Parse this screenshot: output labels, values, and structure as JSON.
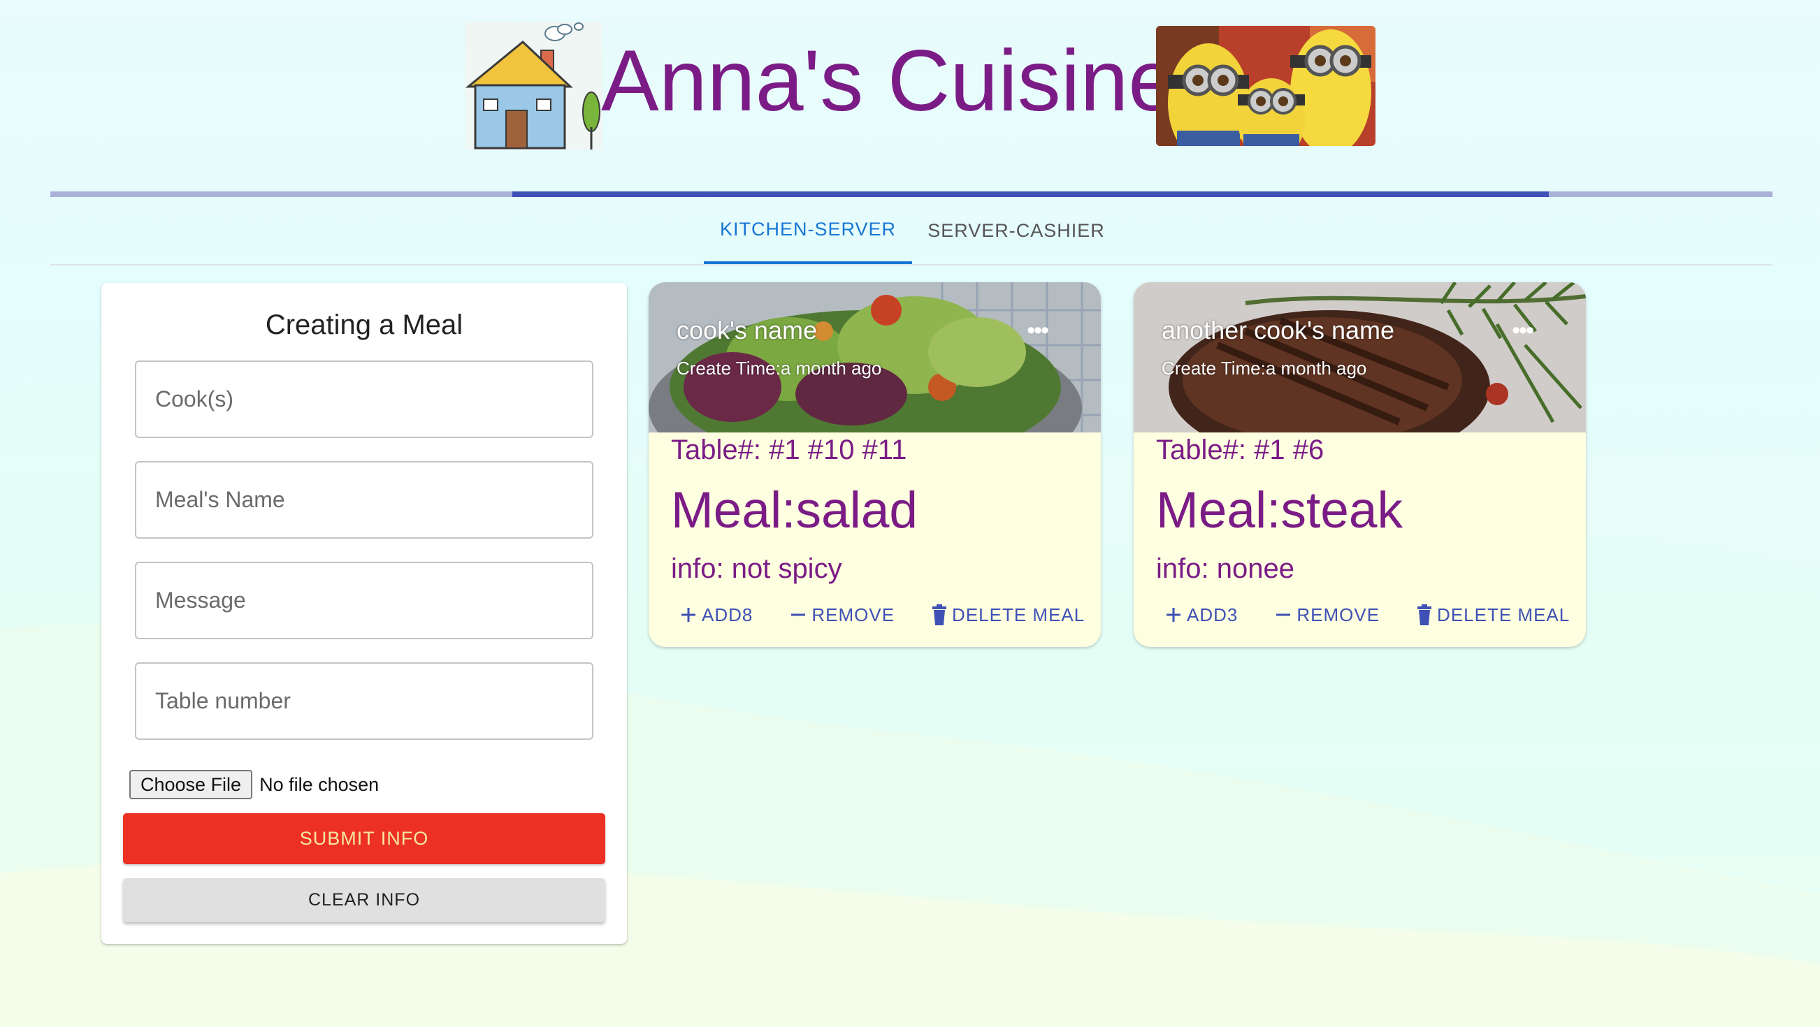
{
  "header": {
    "title": "Anna's Cuisine",
    "left_image": "house-illustration",
    "right_image": "minions-photo"
  },
  "progress": {
    "value": 0.6
  },
  "tabs": [
    {
      "label": "KITCHEN-SERVER",
      "active": true
    },
    {
      "label": "SERVER-CASHIER",
      "active": false
    }
  ],
  "form": {
    "title": "Creating a Meal",
    "fields": {
      "cooks": {
        "placeholder": "Cook(s)",
        "value": ""
      },
      "meal_name": {
        "placeholder": "Meal's Name",
        "value": ""
      },
      "message": {
        "placeholder": "Message",
        "value": ""
      },
      "table_number": {
        "placeholder": "Table number",
        "value": ""
      }
    },
    "file_button": "Choose File",
    "file_status": "No file chosen",
    "submit_label": "SUBMIT INFO",
    "clear_label": "CLEAR INFO",
    "colors": {
      "submit_bg": "#ed3024",
      "submit_text": "#f3e7a1"
    }
  },
  "meals": [
    {
      "image": "salad-photo",
      "cook": "cook's name",
      "create_time": "Create Time:a month ago",
      "tables": "Table#: #1 #10 #11",
      "meal": "Meal:salad",
      "info": "info: not spicy",
      "more_icon": "more-horizontal-icon",
      "add_label": "ADD8",
      "remove_label": "REMOVE",
      "delete_label": "DELETE MEAL"
    },
    {
      "image": "steak-photo",
      "cook": "another cook's name",
      "create_time": "Create Time:a month ago",
      "tables": "Table#: #1 #6",
      "meal": "Meal:steak",
      "info": "info: nonee",
      "more_icon": "more-horizontal-icon",
      "add_label": "ADD3",
      "remove_label": "REMOVE",
      "delete_label": "DELETE MEAL"
    }
  ],
  "colors": {
    "title_purple": "#7b1c86",
    "accent_blue": "#3f51b5",
    "tab_blue": "#1976d2",
    "card_bg": "#fefee0"
  }
}
